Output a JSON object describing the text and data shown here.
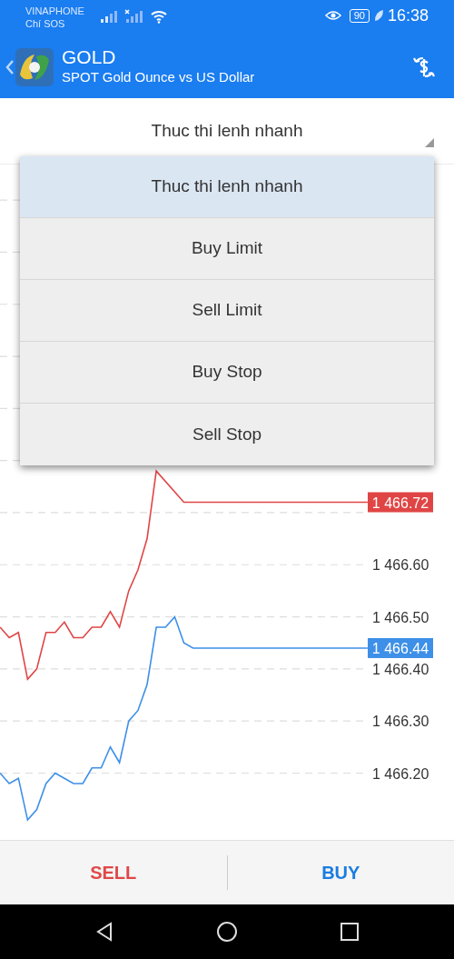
{
  "status_bar": {
    "carrier": "VINAPHONE",
    "carrier_note": "Chí SOS",
    "battery": "90",
    "time": "16:38"
  },
  "app_bar": {
    "title": "GOLD",
    "subtitle": "SPOT Gold Ounce vs US Dollar"
  },
  "order_type": {
    "value": "Thuc thi lenh nhanh",
    "expanded": true
  },
  "menu": [
    {
      "label": "Thuc thi lenh nhanh",
      "selected": true
    },
    {
      "label": "Buy Limit",
      "selected": false
    },
    {
      "label": "Sell Limit",
      "selected": false
    },
    {
      "label": "Buy Stop",
      "selected": false
    },
    {
      "label": "Sell Stop",
      "selected": false
    }
  ],
  "chart": {
    "current_prices": [
      "1 466.72",
      "1 466.44"
    ],
    "chart_data": {
      "type": "line",
      "grid": true,
      "ylim": [
        1466.07,
        1467.37
      ],
      "yticks": [
        {
          "value": 1466.6,
          "label": "1 466.60"
        },
        {
          "value": 1466.5,
          "label": "1 466.50"
        },
        {
          "value": 1466.4,
          "label": "1 466.40"
        },
        {
          "value": 1466.3,
          "label": "1 466.30"
        },
        {
          "value": 1466.2,
          "label": "1 466.20"
        }
      ],
      "series": [
        {
          "color": "#e04545",
          "values": [
            1466.48,
            1466.46,
            1466.47,
            1466.38,
            1466.4,
            1466.47,
            1466.47,
            1466.49,
            1466.46,
            1466.46,
            1466.48,
            1466.48,
            1466.51,
            1466.48,
            1466.55,
            1466.59,
            1466.65,
            1466.78,
            null,
            null,
            1466.72,
            1466.72,
            1466.72,
            1466.72,
            1466.72,
            1466.72,
            1466.72,
            1466.72,
            1466.72,
            1466.72,
            1466.72,
            1466.72,
            1466.72,
            1466.72,
            1466.72,
            1466.72,
            1466.72,
            1466.72,
            1466.72,
            1466.72,
            1466.72
          ]
        },
        {
          "color": "#3d8fe8",
          "values": [
            1466.2,
            1466.18,
            1466.19,
            1466.11,
            1466.13,
            1466.18,
            1466.2,
            1466.19,
            1466.18,
            1466.18,
            1466.21,
            1466.21,
            1466.25,
            1466.22,
            1466.3,
            1466.32,
            1466.37,
            1466.48,
            1466.48,
            1466.5,
            1466.45,
            1466.44,
            1466.44,
            1466.44,
            1466.44,
            1466.44,
            1466.44,
            1466.44,
            1466.44,
            1466.44,
            1466.44,
            1466.44,
            1466.44,
            1466.44,
            1466.44,
            1466.44,
            1466.44,
            1466.44,
            1466.44,
            1466.44,
            1466.44
          ]
        }
      ]
    }
  },
  "actions": [
    {
      "label": "SELL",
      "kind": "sell"
    },
    {
      "label": "BUY",
      "kind": "buy"
    }
  ]
}
